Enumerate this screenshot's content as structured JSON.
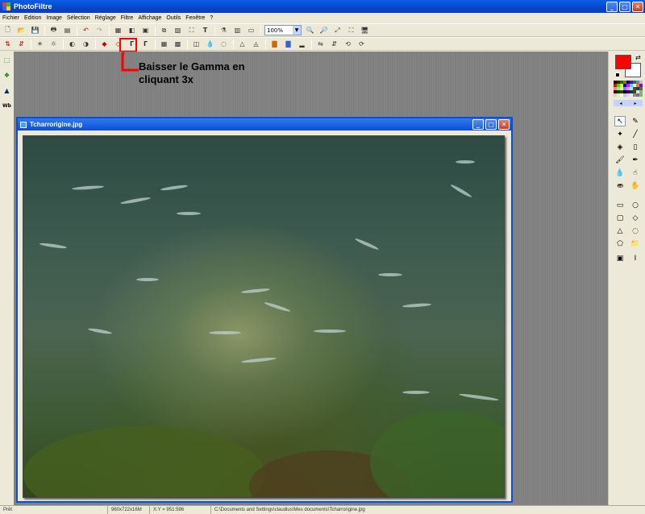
{
  "window": {
    "title": "PhotoFiltre"
  },
  "menu": [
    "Fichier",
    "Edition",
    "Image",
    "Sélection",
    "Réglage",
    "Filtre",
    "Affichage",
    "Outils",
    "Fenêtre",
    "?"
  ],
  "toolbar": {
    "zoom_value": "100%"
  },
  "annotation": {
    "line1": "Baisser le Gamma en",
    "line2": "cliquant 3x"
  },
  "document": {
    "title": "Tcharrorigine.jpg"
  },
  "left_tools": {
    "wb_label": "Wb"
  },
  "colors": {
    "foreground": "#ff0000",
    "background": "#ffffff",
    "highlight": "#ff0000",
    "titlebar": "#0a4fd6"
  },
  "status": {
    "state": "Prêt",
    "dimensions": "960x722x16M",
    "coords": "X:Y = 951:596",
    "path": "C:\\Documents and Settings\\claudius\\Mes documents\\Tcharrorigine.jpg"
  }
}
